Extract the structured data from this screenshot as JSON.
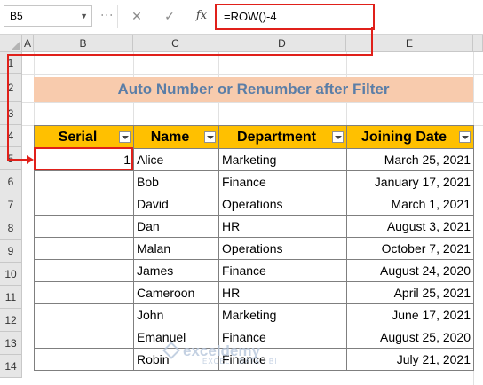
{
  "name_box": "B5",
  "formula_bar": {
    "cancel_icon": "✕",
    "enter_icon": "✓",
    "fx_label": "fx",
    "formula": "=ROW()-4"
  },
  "columns": [
    "A",
    "B",
    "C",
    "D",
    "E"
  ],
  "rows": [
    "1",
    "2",
    "3",
    "4",
    "5",
    "6",
    "7",
    "8",
    "9",
    "10",
    "11",
    "12",
    "13",
    "14"
  ],
  "title": "Auto Number or Renumber after Filter",
  "table": {
    "headers": [
      "Serial",
      "Name",
      "Department",
      "Joining Date"
    ],
    "rows": [
      {
        "serial": "1",
        "name": "Alice",
        "department": "Marketing",
        "date": "March 25, 2021"
      },
      {
        "serial": "",
        "name": "Bob",
        "department": "Finance",
        "date": "January 17, 2021"
      },
      {
        "serial": "",
        "name": "David",
        "department": "Operations",
        "date": "March 1, 2021"
      },
      {
        "serial": "",
        "name": "Dan",
        "department": "HR",
        "date": "August 3, 2021"
      },
      {
        "serial": "",
        "name": "Malan",
        "department": "Operations",
        "date": "October 7, 2021"
      },
      {
        "serial": "",
        "name": "James",
        "department": "Finance",
        "date": "August 24, 2020"
      },
      {
        "serial": "",
        "name": "Cameroon",
        "department": "HR",
        "date": "April 25, 2021"
      },
      {
        "serial": "",
        "name": "John",
        "department": "Marketing",
        "date": "June 17, 2021"
      },
      {
        "serial": "",
        "name": "Emanuel",
        "department": "Finance",
        "date": "August 25, 2020"
      },
      {
        "serial": "",
        "name": "Robin",
        "department": "Finance",
        "date": "July 21, 2021"
      }
    ]
  },
  "watermark": {
    "name": "exceldemy",
    "tagline": "EXCEL · DATA · BI"
  },
  "colors": {
    "header_fill": "#ffc000",
    "title_fill": "#f8cbad",
    "title_text": "#5b7ea7",
    "highlight": "#e0201a"
  }
}
